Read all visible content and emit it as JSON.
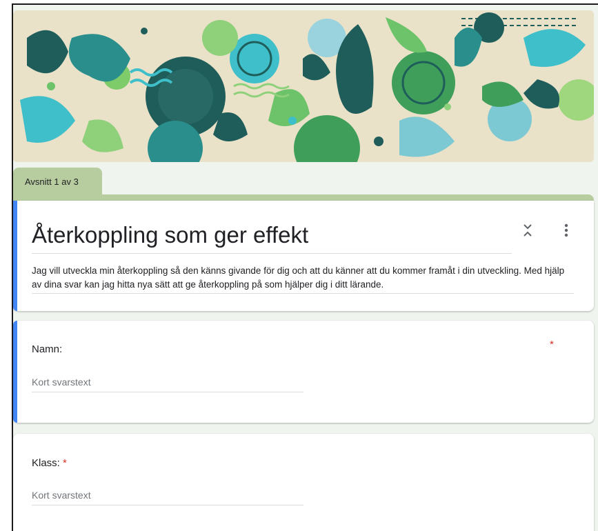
{
  "section": {
    "label": "Avsnitt 1 av 3"
  },
  "form": {
    "title": "Återkoppling som ger effekt",
    "description": "Jag vill utveckla min återkoppling så den känns givande för dig och att du känner att du kommer framåt i din utveckling. Med hjälp av dina svar kan jag hitta nya sätt att ge återkoppling på som hjälper dig i ditt lärande."
  },
  "questions": [
    {
      "label": "Namn:",
      "required_mark": "*",
      "placeholder": "Kort svarstext"
    },
    {
      "label": "Klass:",
      "required_mark": "*",
      "placeholder": "Kort svarstext"
    }
  ],
  "colors": {
    "accent": "#4285f4",
    "section_tab": "#b7cd9f",
    "required": "#d93025",
    "background": "#f0f4ef"
  },
  "icons": {
    "collapse": "collapse-section-icon",
    "more": "more-vert-icon"
  }
}
